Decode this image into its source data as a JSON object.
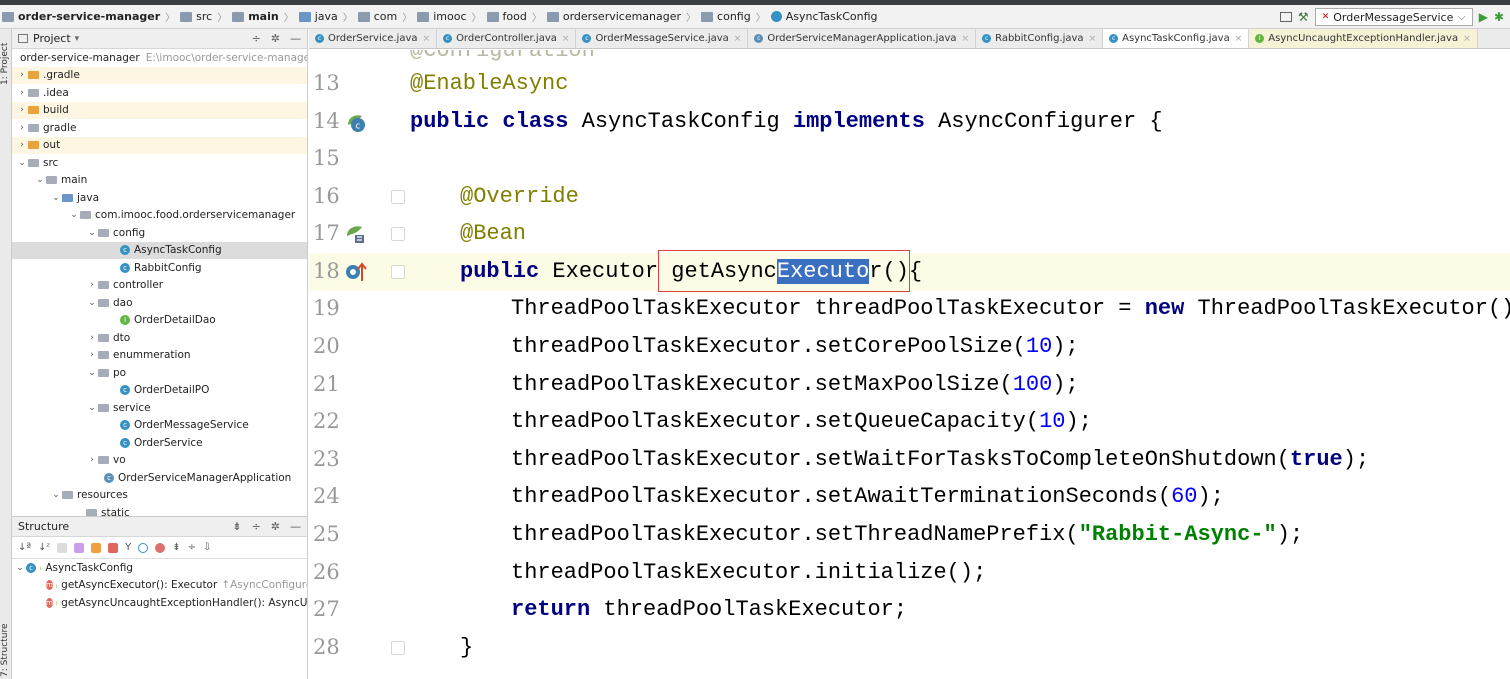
{
  "breadcrumb": [
    {
      "label": "order-service-manager",
      "bold": true
    },
    {
      "label": "src",
      "bold": false
    },
    {
      "label": "main",
      "bold": true
    },
    {
      "label": "java",
      "bold": false
    },
    {
      "label": "com",
      "bold": false
    },
    {
      "label": "imooc",
      "bold": false
    },
    {
      "label": "food",
      "bold": false
    },
    {
      "label": "orderservicemanager",
      "bold": false
    },
    {
      "label": "config",
      "bold": false
    },
    {
      "label": "AsyncTaskConfig",
      "bold": false
    }
  ],
  "run_config": {
    "label": "OrderMessageService"
  },
  "side_tabs": {
    "project": "1: Project",
    "structure": "7: Structure"
  },
  "project": {
    "header": "Project",
    "root_label": "order-service-manager",
    "root_path": "E:\\imooc\\order-service-manage",
    "items": [
      {
        "label": ".gradle"
      },
      {
        "label": ".idea"
      },
      {
        "label": "build"
      },
      {
        "label": "gradle"
      },
      {
        "label": "out"
      },
      {
        "label": "src"
      },
      {
        "label": "main"
      },
      {
        "label": "java"
      },
      {
        "label": "com.imooc.food.orderservicemanager"
      },
      {
        "label": "config"
      },
      {
        "label": "AsyncTaskConfig"
      },
      {
        "label": "RabbitConfig"
      },
      {
        "label": "controller"
      },
      {
        "label": "dao"
      },
      {
        "label": "OrderDetailDao"
      },
      {
        "label": "dto"
      },
      {
        "label": "enummeration"
      },
      {
        "label": "po"
      },
      {
        "label": "OrderDetailPO"
      },
      {
        "label": "service"
      },
      {
        "label": "OrderMessageService"
      },
      {
        "label": "OrderService"
      },
      {
        "label": "vo"
      },
      {
        "label": "OrderServiceManagerApplication"
      },
      {
        "label": "resources"
      },
      {
        "label": "static"
      }
    ]
  },
  "structure": {
    "header": "Structure",
    "root": "AsyncTaskConfig",
    "methods": [
      {
        "label": "getAsyncExecutor(): Executor",
        "hint": "↑AsyncConfigurer"
      },
      {
        "label": "getAsyncUncaughtExceptionHandler(): AsyncUnc",
        "hint": ""
      }
    ]
  },
  "tabs": [
    {
      "label": "OrderService.java",
      "active": false
    },
    {
      "label": "OrderController.java",
      "active": false
    },
    {
      "label": "OrderMessageService.java",
      "active": false
    },
    {
      "label": "OrderServiceManagerApplication.java",
      "active": false
    },
    {
      "label": "RabbitConfig.java",
      "active": false
    },
    {
      "label": "AsyncTaskConfig.java",
      "active": true
    },
    {
      "label": "AsyncUncaughtExceptionHandler.java",
      "active": false
    }
  ],
  "editor": {
    "line_numbers": [
      "13",
      "14",
      "15",
      "16",
      "17",
      "18",
      "19",
      "20",
      "21",
      "22",
      "23",
      "24",
      "25",
      "26",
      "27",
      "28"
    ],
    "lines": {
      "l13": "@EnableAsync",
      "l14_a": "public class ",
      "l14_b": "AsyncTaskConfig ",
      "l14_c": "implements ",
      "l14_d": "AsyncConfigurer {",
      "l16": "@Override",
      "l17": "@Bean",
      "l18_a": "public ",
      "l18_b": "Executor ",
      "l18_c": "getAsync",
      "l18_d": "Executo",
      "l18_e": "r(){",
      "l19_a": "ThreadPoolTaskExecutor threadPoolTaskExecutor = ",
      "l19_b": "new ",
      "l19_c": "ThreadPoolTaskExecutor();",
      "l20_a": "threadPoolTaskExecutor.setCorePoolSize(",
      "l20_b": "10",
      "l20_c": ");",
      "l21_a": "threadPoolTaskExecutor.setMaxPoolSize(",
      "l21_b": "100",
      "l21_c": ");",
      "l22_a": "threadPoolTaskExecutor.setQueueCapacity(",
      "l22_b": "10",
      "l22_c": ");",
      "l23_a": "threadPoolTaskExecutor.setWaitForTasksToCompleteOnShutdown(",
      "l23_b": "true",
      "l23_c": ");",
      "l24_a": "threadPoolTaskExecutor.setAwaitTerminationSeconds(",
      "l24_b": "60",
      "l24_c": ");",
      "l25_a": "threadPoolTaskExecutor.setThreadNamePrefix(",
      "l25_b": "\"Rabbit-Async-\"",
      "l25_c": ");",
      "l26": "threadPoolTaskExecutor.initialize();",
      "l27_a": "return ",
      "l27_b": "threadPoolTaskExecutor;",
      "l28": "}"
    }
  },
  "colors": {
    "keyword": "#000080",
    "annotation": "#808000",
    "number": "#0000ff",
    "string": "#008000",
    "selection": "#3b6fbf",
    "highlight_box": "#e04040"
  }
}
